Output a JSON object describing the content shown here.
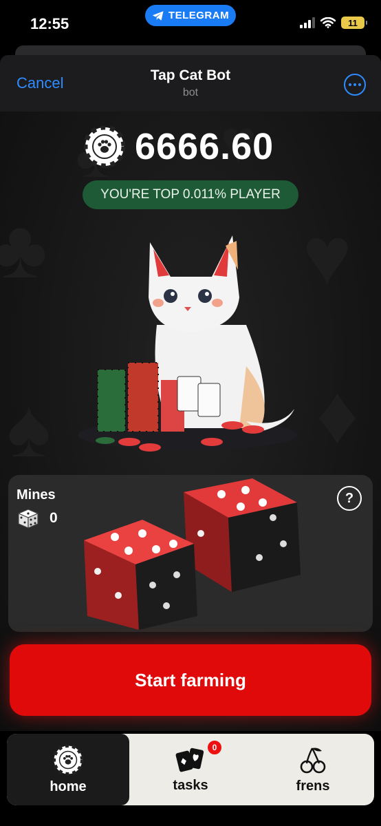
{
  "status_bar": {
    "time": "12:55",
    "app_pill": "TELEGRAM",
    "battery": "11"
  },
  "header": {
    "cancel": "Cancel",
    "title": "Tap Cat Bot",
    "subtitle": "bot",
    "more_icon": "ellipsis-circle-icon"
  },
  "balance": {
    "value": "6666.60",
    "icon": "paw-chip-icon"
  },
  "rank": {
    "text": "YOU'RE TOP 0.011% PLAYER"
  },
  "mines": {
    "title": "Mines",
    "count": "0",
    "help": "?"
  },
  "action": {
    "label": "Start farming"
  },
  "tabs": [
    {
      "label": "home",
      "icon": "paw-chip-icon",
      "active": true
    },
    {
      "label": "tasks",
      "icon": "cards-icon",
      "badge": "0"
    },
    {
      "label": "frens",
      "icon": "cherries-icon"
    }
  ],
  "colors": {
    "accent_red": "#e00a0a",
    "badge_green": "#1f5a37",
    "link_blue": "#2f8cff",
    "telegram_blue": "#1a7cf5"
  }
}
